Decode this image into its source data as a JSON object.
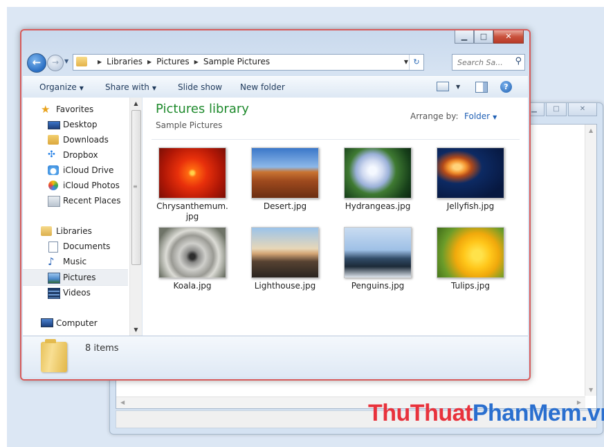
{
  "breadcrumb": [
    "Libraries",
    "Pictures",
    "Sample Pictures"
  ],
  "search": {
    "placeholder": "Search Sa..."
  },
  "toolbar": {
    "organize": "Organize",
    "share_with": "Share with",
    "slide_show": "Slide show",
    "new_folder": "New folder"
  },
  "nav": {
    "favorites": "Favorites",
    "desktop": "Desktop",
    "downloads": "Downloads",
    "dropbox": "Dropbox",
    "icloud_drive": "iCloud Drive",
    "icloud_photos": "iCloud Photos",
    "recent_places": "Recent Places",
    "libraries": "Libraries",
    "documents": "Documents",
    "music": "Music",
    "pictures": "Pictures",
    "videos": "Videos",
    "computer": "Computer"
  },
  "main": {
    "title": "Pictures library",
    "subtitle": "Sample Pictures",
    "arrange_label": "Arrange by:",
    "arrange_value": "Folder"
  },
  "files": [
    {
      "name": "Chrysanthemum.",
      "name2": "jpg"
    },
    {
      "name": "Desert.jpg"
    },
    {
      "name": "Hydrangeas.jpg"
    },
    {
      "name": "Jellyfish.jpg"
    },
    {
      "name": "Koala.jpg"
    },
    {
      "name": "Lighthouse.jpg"
    },
    {
      "name": "Penguins.jpg"
    },
    {
      "name": "Tulips.jpg"
    }
  ],
  "status": {
    "item_count": "8 items"
  },
  "watermark": {
    "part1": "ThuThuat",
    "part2": "PhanMem.vn"
  },
  "colors": {
    "library_title": "#1e8a2c",
    "arrange_link": "#1f5fb4",
    "window_border": "#d85a5a"
  }
}
